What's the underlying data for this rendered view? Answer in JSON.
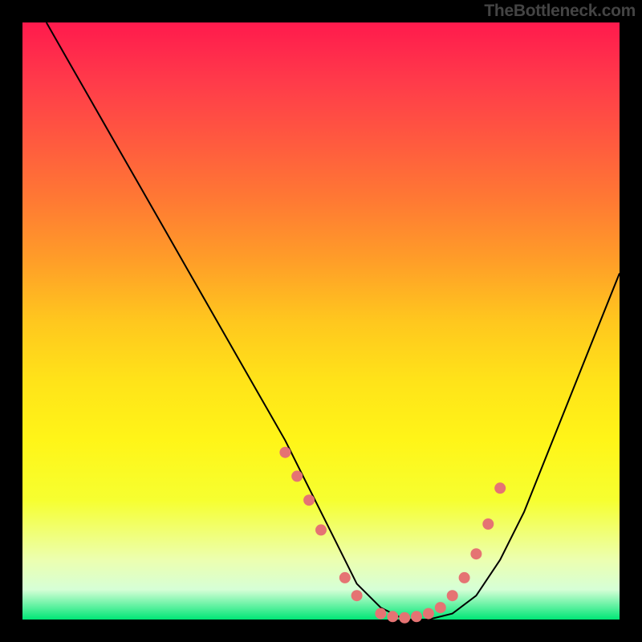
{
  "watermark": "TheBottleneck.com",
  "chart_data": {
    "type": "line",
    "title": "",
    "xlabel": "",
    "ylabel": "",
    "xlim": [
      0,
      100
    ],
    "ylim": [
      0,
      100
    ],
    "series": [
      {
        "name": "curve",
        "x": [
          4,
          8,
          12,
          16,
          20,
          24,
          28,
          32,
          36,
          40,
          44,
          48,
          52,
          56,
          60,
          64,
          68,
          72,
          76,
          80,
          84,
          88,
          92,
          96,
          100
        ],
        "values": [
          100,
          93,
          86,
          79,
          72,
          65,
          58,
          51,
          44,
          37,
          30,
          22,
          14,
          6,
          2,
          0,
          0,
          1,
          4,
          10,
          18,
          28,
          38,
          48,
          58
        ]
      }
    ],
    "markers": {
      "x": [
        44,
        46,
        48,
        50,
        54,
        56,
        60,
        62,
        64,
        66,
        68,
        70,
        72,
        74,
        76,
        78,
        80
      ],
      "y": [
        28,
        24,
        20,
        15,
        7,
        4,
        1,
        0.5,
        0.3,
        0.5,
        1,
        2,
        4,
        7,
        11,
        16,
        22
      ]
    }
  }
}
